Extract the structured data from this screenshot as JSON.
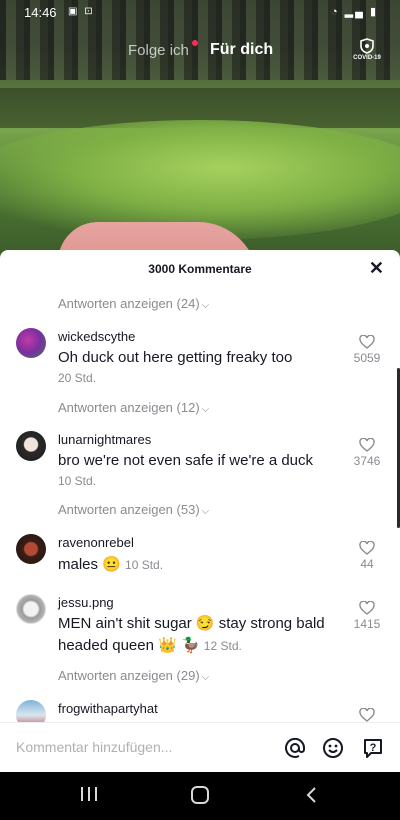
{
  "status": {
    "time": "14:46"
  },
  "top_nav": {
    "following": "Folge ich",
    "for_you": "Für dich",
    "covid_label": "COVID-19"
  },
  "sheet": {
    "title": "3000 Kommentare",
    "close": "✕",
    "replies_1": "Antworten anzeigen (24)",
    "comments": [
      {
        "username": "wickedscythe",
        "text": "Oh duck out here getting freaky too",
        "time": "20 Std.",
        "likes": "5059",
        "replies": "Antworten anzeigen (12)"
      },
      {
        "username": "lunarnightmares",
        "text": "bro we're not even safe if we're a duck",
        "time": "10 Std.",
        "likes": "3746",
        "replies": "Antworten anzeigen (53)"
      },
      {
        "username": "ravenonrebel",
        "text": "males 😐",
        "time": "10 Std.",
        "likes": "44"
      },
      {
        "username": "jessu.png",
        "text": "MEN ain't shit sugar 😏 stay strong bald headed queen 👑 🦆",
        "time": "12 Std.",
        "likes": "1415",
        "replies": "Antworten anzeigen (29)"
      },
      {
        "username": "frogwithapartyhat"
      }
    ]
  },
  "input": {
    "placeholder": "Kommentar hinzufügen..."
  },
  "colors": {
    "accent_dot": "#fe2c55",
    "text": "#161823",
    "muted": "#8a8b91"
  }
}
